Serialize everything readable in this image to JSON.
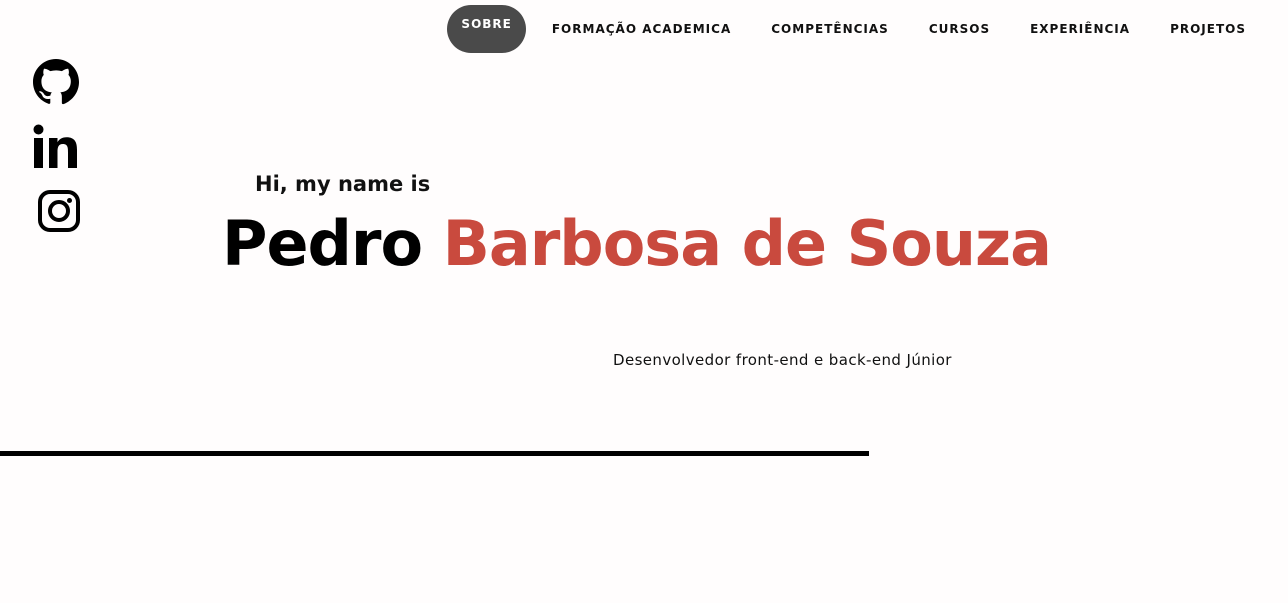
{
  "nav": {
    "items": [
      {
        "label": "SOBRE"
      },
      {
        "label": "FORMAÇÃO ACADEMICA"
      },
      {
        "label": "COMPETÊNCIAS"
      },
      {
        "label": "CURSOS"
      },
      {
        "label": "EXPERIÊNCIA"
      },
      {
        "label": "PROJETOS"
      }
    ],
    "active": "SOBRE"
  },
  "social": [
    {
      "icon": "github-icon"
    },
    {
      "icon": "linkedin-icon"
    },
    {
      "icon": "instagram-icon"
    }
  ],
  "hero": {
    "greeting": "Hi, my name is",
    "first_name": "Pedro",
    "last_name": "Barbosa de Souza",
    "role": "Desenvolvedor front-end e back-end Júnior"
  },
  "colors": {
    "accent": "#c94a3e",
    "nav_active_bg": "#4a4a4a",
    "text": "#000000"
  }
}
